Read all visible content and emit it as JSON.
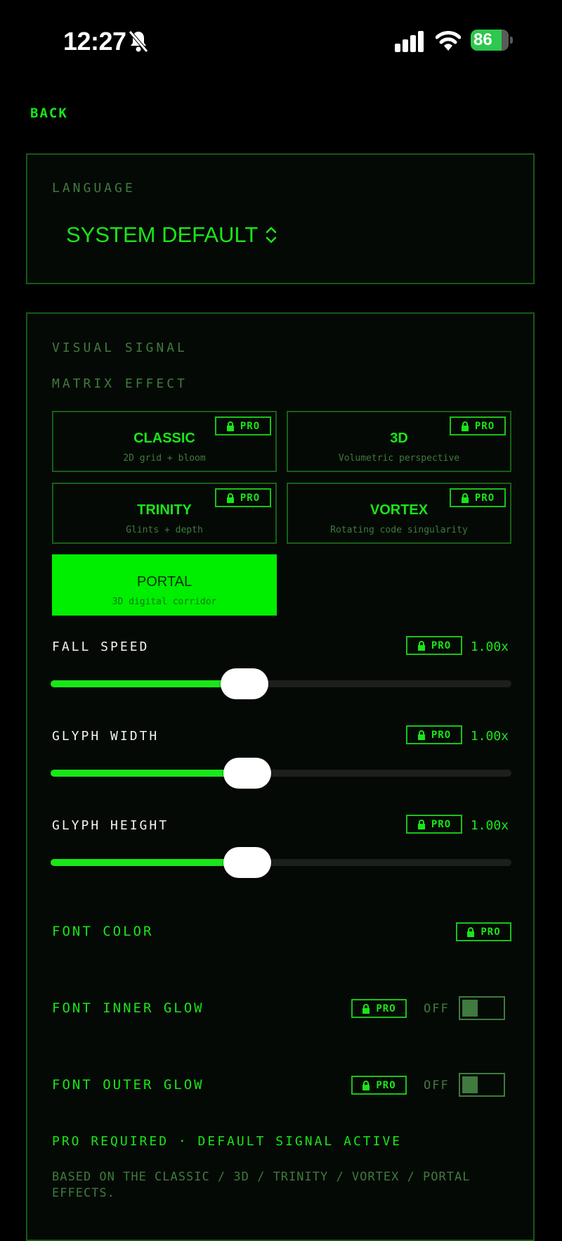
{
  "status_bar": {
    "time": "12:27",
    "battery": "86"
  },
  "nav": {
    "back_label": "BACK"
  },
  "language": {
    "section_label": "LANGUAGE",
    "value": "SYSTEM DEFAULT"
  },
  "visual_signal": {
    "section_label": "VISUAL SIGNAL",
    "matrix_label": "MATRIX EFFECT",
    "pro_label": "PRO",
    "effects": [
      {
        "title": "CLASSIC",
        "subtitle": "2D grid + bloom"
      },
      {
        "title": "3D",
        "subtitle": "Volumetric perspective"
      },
      {
        "title": "TRINITY",
        "subtitle": "Glints + depth"
      },
      {
        "title": "VORTEX",
        "subtitle": "Rotating code singularity"
      },
      {
        "title": "PORTAL",
        "subtitle": "3D digital corridor"
      }
    ],
    "selected_effect": "PORTAL",
    "sliders": [
      {
        "label": "FALL SPEED",
        "value": "1.00x",
        "fraction": 0.42
      },
      {
        "label": "GLYPH WIDTH",
        "value": "1.00x",
        "fraction": 0.427
      },
      {
        "label": "GLYPH HEIGHT",
        "value": "1.00x",
        "fraction": 0.427
      }
    ],
    "font_color_label": "FONT COLOR",
    "inner_glow": {
      "label": "FONT INNER GLOW",
      "state": "OFF"
    },
    "outer_glow": {
      "label": "FONT OUTER GLOW",
      "state": "OFF"
    },
    "pro_required": "PRO REQUIRED · DEFAULT SIGNAL ACTIVE",
    "note": "BASED ON THE CLASSIC / 3D / TRINITY / VORTEX / PORTAL EFFECTS."
  },
  "colors": {
    "accent": "#19e619",
    "muted": "#3f7a3f",
    "border": "#145a14",
    "background": "#000000"
  }
}
